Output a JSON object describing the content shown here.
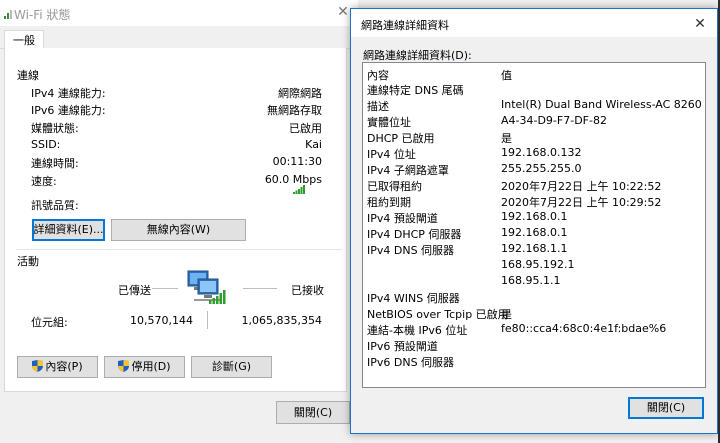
{
  "wifi_window": {
    "title": "Wi-Fi 狀態",
    "tab_general": "一般",
    "connection_section": "連線",
    "rows": [
      {
        "label": "IPv4 連線能力:",
        "value": "網際網路"
      },
      {
        "label": "IPv6 連線能力:",
        "value": "無網路存取"
      },
      {
        "label": "媒體狀態:",
        "value": "已啟用"
      },
      {
        "label": "SSID:",
        "value": "Kai"
      },
      {
        "label": "連線時間:",
        "value": "00:11:30"
      },
      {
        "label": "速度:",
        "value": "60.0 Mbps"
      }
    ],
    "signal_quality_label": "訊號品質:",
    "details_button": "詳細資料(E)...",
    "wireless_properties_button": "無線內容(W)",
    "activity_section": "活動",
    "sent_label": "已傳送",
    "received_label": "已接收",
    "bytes_label": "位元組:",
    "bytes_sent": "10,570,144",
    "bytes_received": "1,065,835,354",
    "properties_button": "內容(P)",
    "disable_button": "停用(D)",
    "diagnose_button": "診斷(G)",
    "close_button": "關閉(C)"
  },
  "details_dialog": {
    "title": "網路連線詳細資料",
    "list_label": "網路連線詳細資料(D):",
    "header_property": "內容",
    "header_value": "值",
    "rows": [
      {
        "property": "連線特定 DNS 尾碼",
        "value": ""
      },
      {
        "property": "描述",
        "value": "Intel(R) Dual Band Wireless-AC 8260"
      },
      {
        "property": "實體位址",
        "value": "A4-34-D9-F7-DF-82"
      },
      {
        "property": "DHCP 已啟用",
        "value": "是"
      },
      {
        "property": "IPv4 位址",
        "value": "192.168.0.132"
      },
      {
        "property": "IPv4 子網路遮罩",
        "value": "255.255.255.0"
      },
      {
        "property": "已取得租約",
        "value": "2020年7月22日 上午 10:22:52"
      },
      {
        "property": "租約到期",
        "value": "2020年7月22日 上午 10:29:52"
      },
      {
        "property": "IPv4 預設閘道",
        "value": "192.168.0.1"
      },
      {
        "property": "IPv4 DHCP 伺服器",
        "value": "192.168.0.1"
      },
      {
        "property": "IPv4 DNS 伺服器",
        "value": "192.168.1.1"
      },
      {
        "property": "",
        "value": "168.95.192.1"
      },
      {
        "property": "",
        "value": "168.95.1.1"
      },
      {
        "property": "IPv4 WINS 伺服器",
        "value": ""
      },
      {
        "property": "NetBIOS over Tcpip 已啟用",
        "value": "是"
      },
      {
        "property": "連結-本機 IPv6 位址",
        "value": "fe80::cca4:68c0:4e1f:bdae%6"
      },
      {
        "property": "IPv6 預設閘道",
        "value": ""
      },
      {
        "property": "IPv6 DNS 伺服器",
        "value": ""
      }
    ],
    "close_button": "關閉(C)"
  },
  "colors": {
    "accent": "#0078d7",
    "signal_green": "#2e9e2e",
    "dialog_border": "#1a73c8"
  }
}
